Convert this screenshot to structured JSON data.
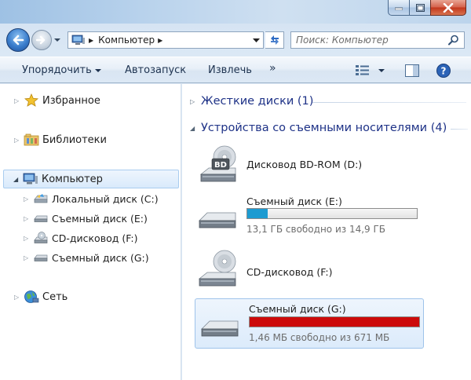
{
  "window": {
    "caption": {
      "minimize": "—",
      "maximize": "□",
      "close": "✕"
    }
  },
  "address": {
    "crumbs": [
      "Компьютер"
    ],
    "search_placeholder": "Поиск: Компьютер"
  },
  "toolbar": {
    "organize_label": "Упорядочить",
    "autoplay_label": "Автозапуск",
    "eject_label": "Извлечь",
    "more_label": "»"
  },
  "sidebar": {
    "favorites": "Избранное",
    "libraries": "Библиотеки",
    "computer": "Компьютер",
    "drives": [
      {
        "label": "Локальный диск (C:)",
        "icon": "local-disk-icon"
      },
      {
        "label": "Съемный диск (E:)",
        "icon": "removable-disk-icon"
      },
      {
        "label": "CD-дисковод (F:)",
        "icon": "cd-drive-icon"
      },
      {
        "label": "Съемный диск (G:)",
        "icon": "removable-disk-icon"
      }
    ],
    "network": "Сеть"
  },
  "content": {
    "groups": {
      "hard_disks": "Жесткие диски (1)",
      "removable": "Устройства со съемными носителями (4)"
    },
    "drives": [
      {
        "name": "Дисковод BD-ROM (D:)",
        "icon": "bd-rom-drive-icon"
      },
      {
        "name": "Съемный диск (E:)",
        "icon": "removable-disk-icon",
        "free_text": "13,1 ГБ свободно из 14,9 ГБ",
        "used_fraction": 0.12,
        "bar_color": "#1d9bd1"
      },
      {
        "name": "CD-дисковод (F:)",
        "icon": "cd-drive-icon"
      },
      {
        "name": "Съемный диск (G:)",
        "icon": "removable-disk-icon",
        "free_text": "1,46 МБ свободно из 671 МБ",
        "used_fraction": 0.998,
        "bar_color": "#cc0a0a",
        "selected": true
      }
    ]
  }
}
